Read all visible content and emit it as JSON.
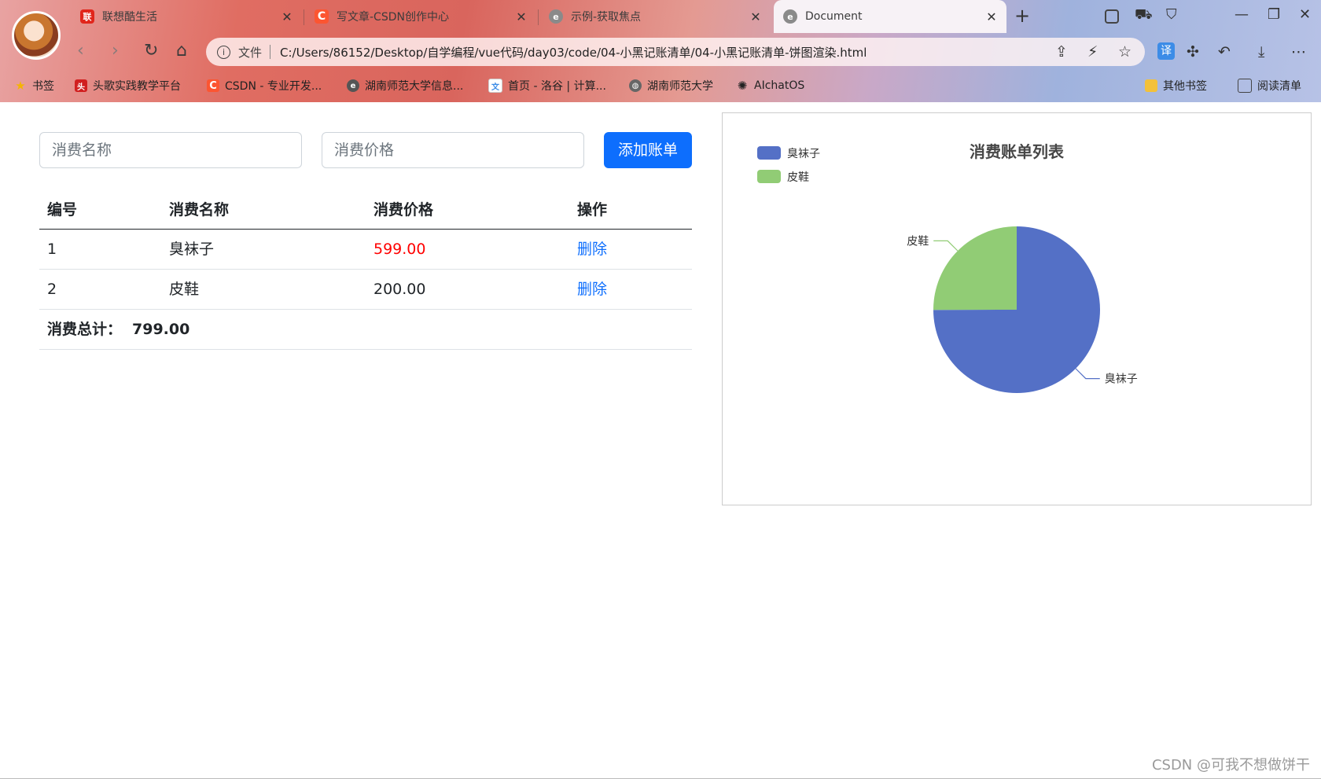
{
  "browser": {
    "tabs": [
      {
        "label": "联想酷生活",
        "icon": "lenovo-icon",
        "color": "#e1251b"
      },
      {
        "label": "写文章-CSDN创作中心",
        "icon": "csdn-icon",
        "color": "#fc5531"
      },
      {
        "label": "示例-获取焦点",
        "icon": "edge-icon",
        "color": "#777777"
      },
      {
        "label": "Document",
        "icon": "edge-icon",
        "color": "#777777"
      }
    ],
    "address": {
      "file_label": "文件",
      "url": "C:/Users/86152/Desktop/自学编程/vue代码/day03/code/04-小黑记账清单/04-小黑记账清单-饼图渲染.html"
    },
    "bookmarks": [
      {
        "label": "书签",
        "icon": "star-icon"
      },
      {
        "label": "头歌实践教学平台",
        "icon": "toge-icon"
      },
      {
        "label": "CSDN - 专业开发...",
        "icon": "csdn-icon"
      },
      {
        "label": "湖南师范大学信息...",
        "icon": "edge-icon"
      },
      {
        "label": "首页 - 洛谷 | 计算...",
        "icon": "luogu-icon"
      },
      {
        "label": "湖南师范大学",
        "icon": "globe-icon"
      },
      {
        "label": "AIchatOS",
        "icon": "openai-icon"
      }
    ],
    "bookmarks_right": [
      {
        "label": "其他书签",
        "icon": "folder-icon"
      },
      {
        "label": "阅读清单",
        "icon": "reading-list-icon"
      }
    ]
  },
  "form": {
    "name_placeholder": "消费名称",
    "price_placeholder": "消费价格",
    "add_button": "添加账单"
  },
  "table": {
    "headers": [
      "编号",
      "消费名称",
      "消费价格",
      "操作"
    ],
    "rows": [
      {
        "id": "1",
        "name": "臭袜子",
        "price": "599.00",
        "action": "删除",
        "highlight": true
      },
      {
        "id": "2",
        "name": "皮鞋",
        "price": "200.00",
        "action": "删除",
        "highlight": false
      }
    ],
    "total_label": "消费总计：",
    "total_value": "799.00"
  },
  "chart_data": {
    "type": "pie",
    "title": "消费账单列表",
    "legend_position": "top-left",
    "series": [
      {
        "data": [
          {
            "name": "臭袜子",
            "value": 599,
            "color": "#5470c6"
          },
          {
            "name": "皮鞋",
            "value": 200,
            "color": "#91cc75"
          }
        ]
      }
    ]
  },
  "watermark": "CSDN @可我不想做饼干",
  "colors": {
    "primary": "#0d6efd",
    "price_highlight": "#ff0000"
  }
}
